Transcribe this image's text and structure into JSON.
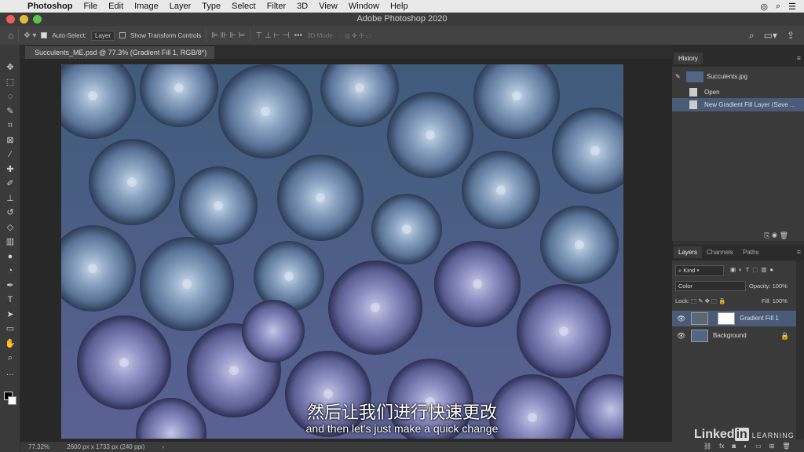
{
  "menubar": {
    "app_name": "Photoshop",
    "items": [
      "File",
      "Edit",
      "Image",
      "Layer",
      "Type",
      "Select",
      "Filter",
      "3D",
      "View",
      "Window",
      "Help"
    ]
  },
  "window": {
    "title": "Adobe Photoshop 2020"
  },
  "options_bar": {
    "auto_select_label": "Auto-Select:",
    "auto_select_value": "Layer",
    "show_transform_label": "Show Transform Controls",
    "mode_3d_label": "3D Mode:"
  },
  "document": {
    "tab_title": "Succulents_ME.psd @ 77.3% (Gradient Fill 1, RGB/8*)",
    "zoom": "77.32%",
    "dimensions": "2600 px x 1733 px (240 ppi)"
  },
  "history": {
    "tab_label": "History",
    "snapshot_label": "Succulents.jpg",
    "states": [
      {
        "label": "Open",
        "selected": false
      },
      {
        "label": "New Gradient Fill Layer (Save ...",
        "selected": true
      }
    ]
  },
  "layers": {
    "tabs": [
      "Layers",
      "Channels",
      "Paths"
    ],
    "filter_kind": "Kind",
    "blend_mode": "Color",
    "opacity_label": "Opacity:",
    "opacity_value": "100%",
    "lock_label": "Lock:",
    "fill_label": "Fill:",
    "fill_value": "100%",
    "items": [
      {
        "name": "Gradient Fill 1",
        "selected": true
      },
      {
        "name": "Background",
        "selected": false
      }
    ]
  },
  "subtitles": {
    "chinese": "然后让我们进行快速更改",
    "english": "and then let's just make a quick change"
  },
  "brand": {
    "linked": "Linked",
    "in": "in",
    "learning": "LEARNING"
  },
  "colors": {
    "photo_tint": "#516686",
    "selection": "#4a5b78"
  }
}
